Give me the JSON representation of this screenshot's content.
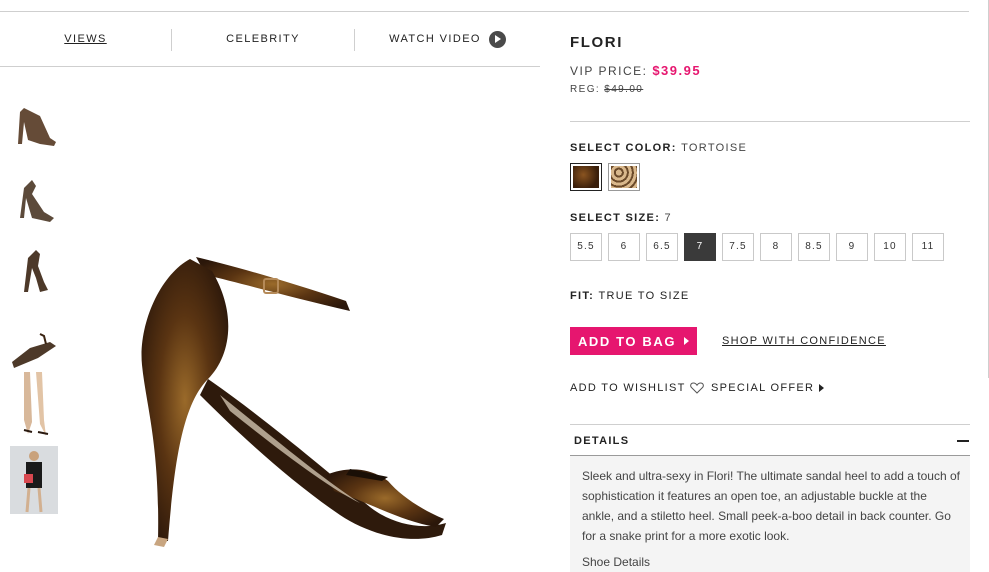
{
  "tabs": {
    "views": "VIEWS",
    "celebrity": "CELEBRITY",
    "watch_video": "WATCH VIDEO"
  },
  "product": {
    "name": "FLORI",
    "vip_label": "VIP PRICE:",
    "vip_price": "$39.95",
    "reg_label": "REG:",
    "reg_price": "$49.00"
  },
  "color": {
    "label": "SELECT COLOR:",
    "selected": "TORTOISE",
    "swatches": [
      {
        "name": "tortoise",
        "hex": "#5a3212"
      },
      {
        "name": "leopard",
        "hex": "#c9a070"
      }
    ]
  },
  "size": {
    "label": "SELECT SIZE:",
    "selected": "7",
    "options": [
      "5.5",
      "6",
      "6.5",
      "7",
      "7.5",
      "8",
      "8.5",
      "9",
      "10",
      "11"
    ]
  },
  "fit": {
    "label": "FIT:",
    "value": "TRUE TO SIZE"
  },
  "actions": {
    "add_to_bag": "ADD TO BAG",
    "shop_confidence": "SHOP WITH CONFIDENCE",
    "add_to_wishlist": "ADD TO WISHLIST",
    "special_offer": "SPECIAL OFFER"
  },
  "details": {
    "heading": "DETAILS",
    "text": "Sleek and ultra-sexy in Flori! The ultimate sandal heel to add a touch of sophistication it features an open toe, an adjustable buckle at the ankle, and a stiletto heel. Small peek-a-boo detail in back counter. Go for a snake print for a more exotic look.",
    "shoe_details_link": "Shoe Details"
  },
  "colors": {
    "accent": "#e6166f",
    "selected_size_bg": "#3a3a3a"
  }
}
